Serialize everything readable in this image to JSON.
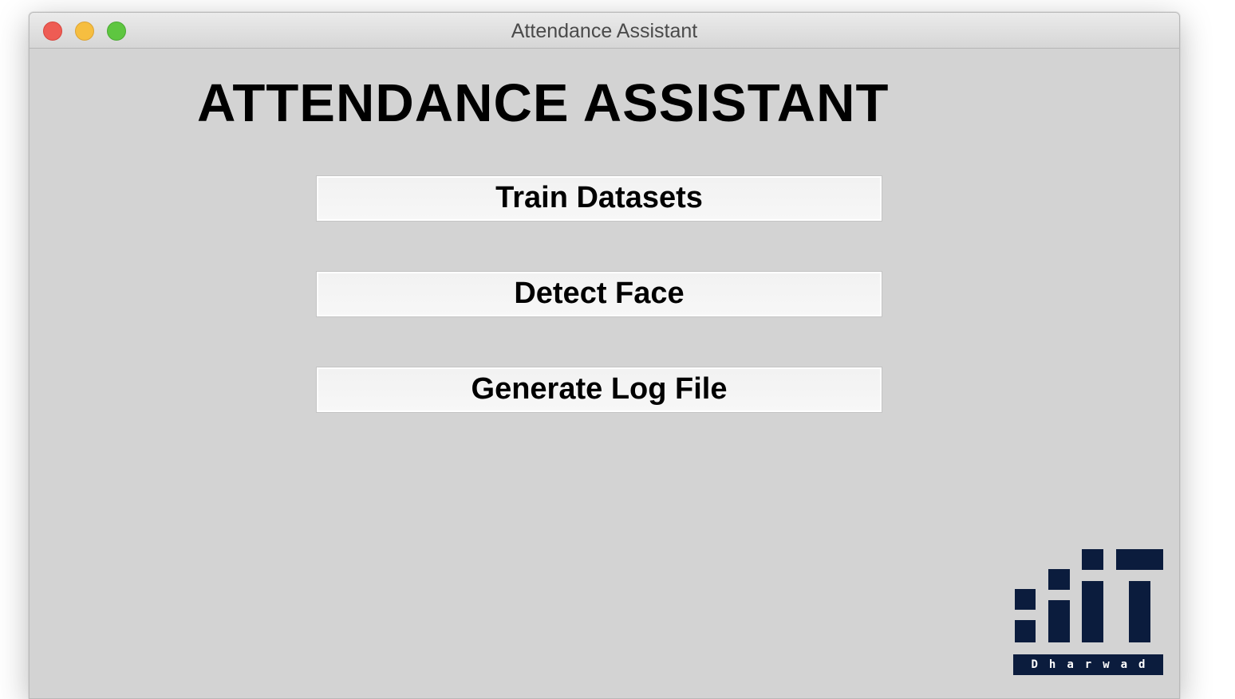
{
  "window": {
    "title": "Attendance Assistant"
  },
  "main": {
    "heading": "ATTENDANCE ASSISTANT",
    "buttons": {
      "train": "Train Datasets",
      "detect": "Detect Face",
      "log": "Generate Log File"
    }
  },
  "logo": {
    "caption": "Dharwad",
    "color": "#0b1c3d"
  },
  "colors": {
    "window_bg": "#d3d3d3",
    "close": "#ee5c54",
    "minimize": "#f6be40",
    "maximize": "#5ec640"
  }
}
